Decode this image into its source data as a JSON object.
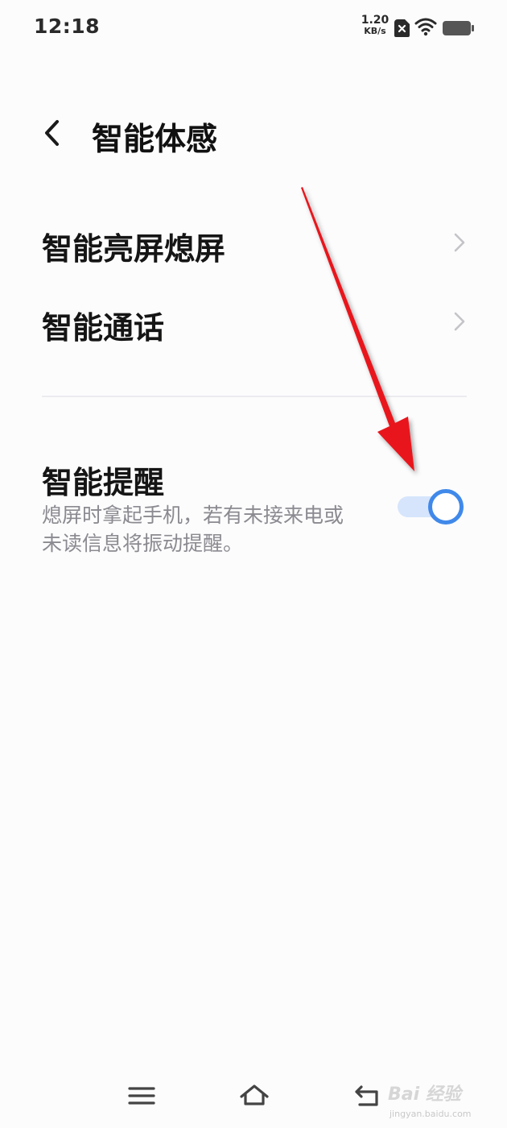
{
  "status_bar": {
    "time": "12:18",
    "net_speed_value": "1.20",
    "net_speed_unit": "KB/s",
    "icons": [
      "sim-error-icon",
      "wifi-icon",
      "battery-icon"
    ]
  },
  "header": {
    "title": "智能体感",
    "back_icon": "chevron-left-icon"
  },
  "items": [
    {
      "label": "智能亮屏熄屏",
      "icon": "chevron-right-icon"
    },
    {
      "label": "智能通话",
      "icon": "chevron-right-icon"
    }
  ],
  "toggle_item": {
    "title": "智能提醒",
    "description": "熄屏时拿起手机，若有未接来电或未读信息将振动提醒。",
    "enabled": true
  },
  "annotation": {
    "type": "red-arrow",
    "target": "toggle_item"
  },
  "nav_bar": {
    "buttons": [
      "menu-icon",
      "home-icon",
      "back-icon"
    ]
  },
  "watermark": {
    "text": "Bai 经验",
    "url": "jingyan.baidu.com"
  },
  "colors": {
    "background": "#fcfcfd",
    "accent": "#4089ea",
    "toggle_track": "#d6e5fb",
    "secondary_text": "#8a8a90",
    "annotation_red": "#e8141c"
  }
}
